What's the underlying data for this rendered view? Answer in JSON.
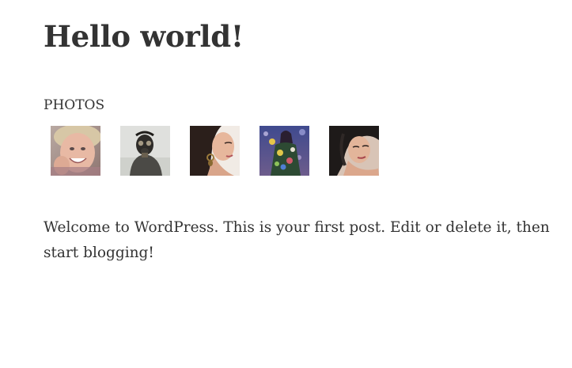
{
  "post": {
    "title": "Hello world!",
    "content": "Welcome to WordPress. This is your first post. Edit or delete it, then start blogging!"
  },
  "gallery": {
    "heading": "PHOTOS",
    "photos": [
      {
        "subject": "smiling-child"
      },
      {
        "subject": "gas-mask-figure"
      },
      {
        "subject": "woman-with-earring"
      },
      {
        "subject": "woman-in-floral-dress"
      },
      {
        "subject": "dark-haired-woman"
      }
    ]
  }
}
